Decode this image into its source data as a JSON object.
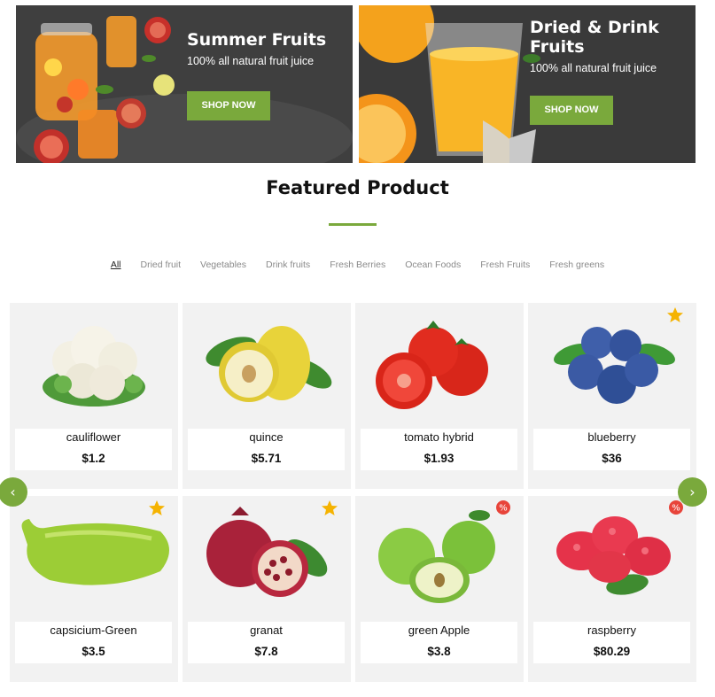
{
  "banners": [
    {
      "title": "Summer Fruits",
      "subtitle": "100% all natural fruit juice",
      "button": "SHOP NOW"
    },
    {
      "title": "Dried & Drink Fruits",
      "subtitle": "100% all natural fruit juice",
      "button": "SHOP NOW"
    }
  ],
  "section": {
    "title": "Featured Product"
  },
  "tabs": [
    "All",
    "Dried fruit",
    "Vegetables",
    "Drink fruits",
    "Fresh Berries",
    "Ocean Foods",
    "Fresh Fruits",
    "Fresh greens"
  ],
  "active_tab": "All",
  "carousel": {
    "prev_icon": "‹",
    "next_icon": "›"
  },
  "products": [
    {
      "name": "cauliflower",
      "price": "$1.2",
      "badge": "none",
      "icon": "cauliflower-image"
    },
    {
      "name": "quince",
      "price": "$5.71",
      "badge": "none",
      "icon": "quince-image"
    },
    {
      "name": "tomato hybrid",
      "price": "$1.93",
      "badge": "none",
      "icon": "tomato-image"
    },
    {
      "name": "blueberry",
      "price": "$36",
      "badge": "star",
      "icon": "blueberry-image"
    },
    {
      "name": "capsicium-Green",
      "price": "$3.5",
      "badge": "star",
      "icon": "green-pepper-image"
    },
    {
      "name": "granat",
      "price": "$7.8",
      "badge": "star",
      "icon": "pomegranate-image"
    },
    {
      "name": "green Apple",
      "price": "$3.8",
      "badge": "sale",
      "icon": "green-apple-image"
    },
    {
      "name": "raspberry",
      "price": "$80.29",
      "badge": "sale",
      "icon": "raspberry-image"
    }
  ],
  "colors": {
    "accent": "#7aa93c",
    "card_bg": "#f2f2f2",
    "star": "#f5b301",
    "sale": "#e8443a"
  }
}
